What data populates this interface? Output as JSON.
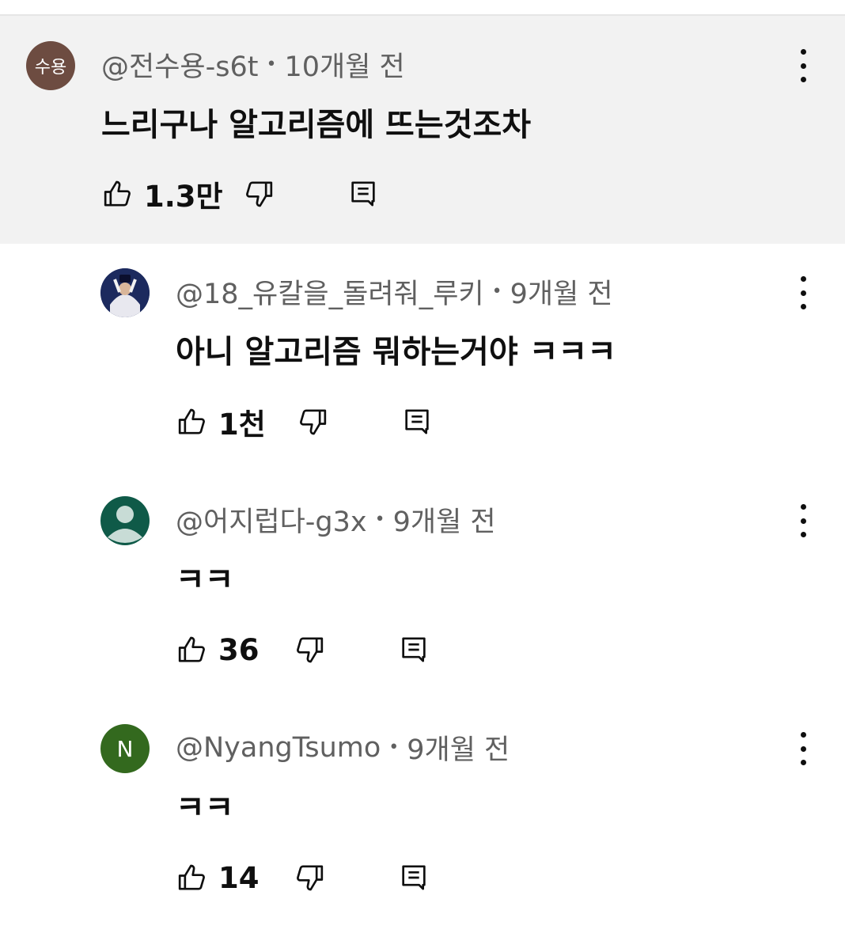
{
  "comments": [
    {
      "avatar_text": "수용",
      "avatar_color": "#6d4c41",
      "handle": "@전수용-s6t",
      "time": "10개월 전",
      "text": "느리구나 알고리즘에 뜨는것조차",
      "likes": "1.3만"
    },
    {
      "avatar_text": "",
      "avatar_color": "#1c2a5e",
      "handle": "@18_유칼을_돌려줘_루키",
      "time": "9개월 전",
      "text": "아니 알고리즘 뭐하는거야 ㅋㅋㅋ",
      "likes": "1천"
    },
    {
      "avatar_text": "",
      "avatar_color": "#0f5a48",
      "handle": "@어지럽다-g3x",
      "time": "9개월 전",
      "text": "ㅋㅋ",
      "likes": "36"
    },
    {
      "avatar_text": "N",
      "avatar_color": "#33691e",
      "handle": "@NyangTsumo",
      "time": "9개월 전",
      "text": "ㅋㅋ",
      "likes": "14"
    }
  ],
  "separator": "•",
  "icons": {
    "like": "thumb-up-icon",
    "dislike": "thumb-down-icon",
    "reply": "reply-icon",
    "menu": "more-vert-icon"
  }
}
